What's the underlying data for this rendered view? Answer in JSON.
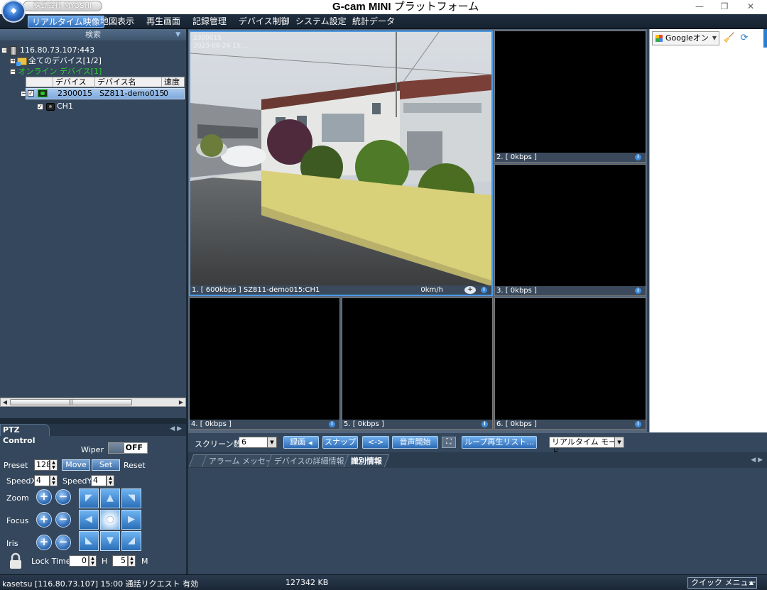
{
  "window": {
    "company_label": "株式会社 MYOSHI",
    "title_main": "G-cam MINI",
    "title_sub": " プラットフォーム",
    "controls": [
      "—",
      "❐",
      "✕"
    ]
  },
  "menu": [
    {
      "label": "リアルタイム映像",
      "active": true
    },
    {
      "label": "地図表示"
    },
    {
      "label": "再生画面"
    },
    {
      "label": "記録管理"
    },
    {
      "label": "デバイス制御"
    },
    {
      "label": "システム設定"
    },
    {
      "label": "統計データ"
    }
  ],
  "left": {
    "search_header": "検索",
    "tree": {
      "server": "116.80.73.107:443",
      "all_devices": "全てのデバイス[1/2]",
      "online_devices": "オンライン デバイス[1]",
      "columns": [
        "デバイス ID",
        "デバイス名",
        "速度"
      ],
      "device": {
        "id": "2300015",
        "name": "SZ811-demo015",
        "speed": "0"
      },
      "channel": "CH1"
    }
  },
  "ptz": {
    "title": "PTZ Control",
    "wiper_label": "Wiper",
    "wiper_state": "OFF",
    "preset_label": "Preset",
    "preset_value": "128",
    "move_label": "Move",
    "set_label": "Set",
    "reset_label": "Reset",
    "speedx_label": "SpeedX",
    "speedx_value": "4",
    "speedy_label": "SpeedY",
    "speedy_value": "4",
    "zoom_label": "Zoom",
    "focus_label": "Focus",
    "iris_label": "Iris",
    "lock_time_label": "Lock Time",
    "lock_h_value": "0",
    "lock_h_unit": "H",
    "lock_m_value": "5",
    "lock_m_unit": "M"
  },
  "tiles": [
    {
      "label": "1. [ 600kbps ] SZ811-demo015:CH1",
      "speed": "0km/h",
      "overlay": [
        "2300015",
        "2023-08-24 15:...",
        "..."
      ]
    },
    {
      "label": "2. [ 0kbps ]"
    },
    {
      "label": "3. [ 0kbps ]"
    },
    {
      "label": "4. [ 0kbps ]"
    },
    {
      "label": "5. [ 0kbps ]"
    },
    {
      "label": "6. [ 0kbps ]"
    }
  ],
  "map": {
    "type_label": "Googleオン"
  },
  "toolbar": {
    "screens_label": "スクリーン数",
    "screens_value": "6",
    "record_label": "録画",
    "snap_label": "スナップ",
    "swap_label": "<->",
    "audio_label": "音声開始",
    "loop_label": "ループ再生リスト...",
    "mode_value": "リアルタイム モード"
  },
  "tabs": [
    {
      "label": "アラーム メッセージ"
    },
    {
      "label": "デバイスの詳細情報"
    },
    {
      "label": "識別情報",
      "active": true
    }
  ],
  "status": {
    "left": "kasetsu [116.80.73.107] 15:00 通話リクエスト 有効",
    "center": "127342 KB",
    "quick_menu": "クイック メニュー"
  },
  "colors": {
    "accent": "#2f6fbf",
    "online": "#2dd12d",
    "panel": "#34475c"
  }
}
